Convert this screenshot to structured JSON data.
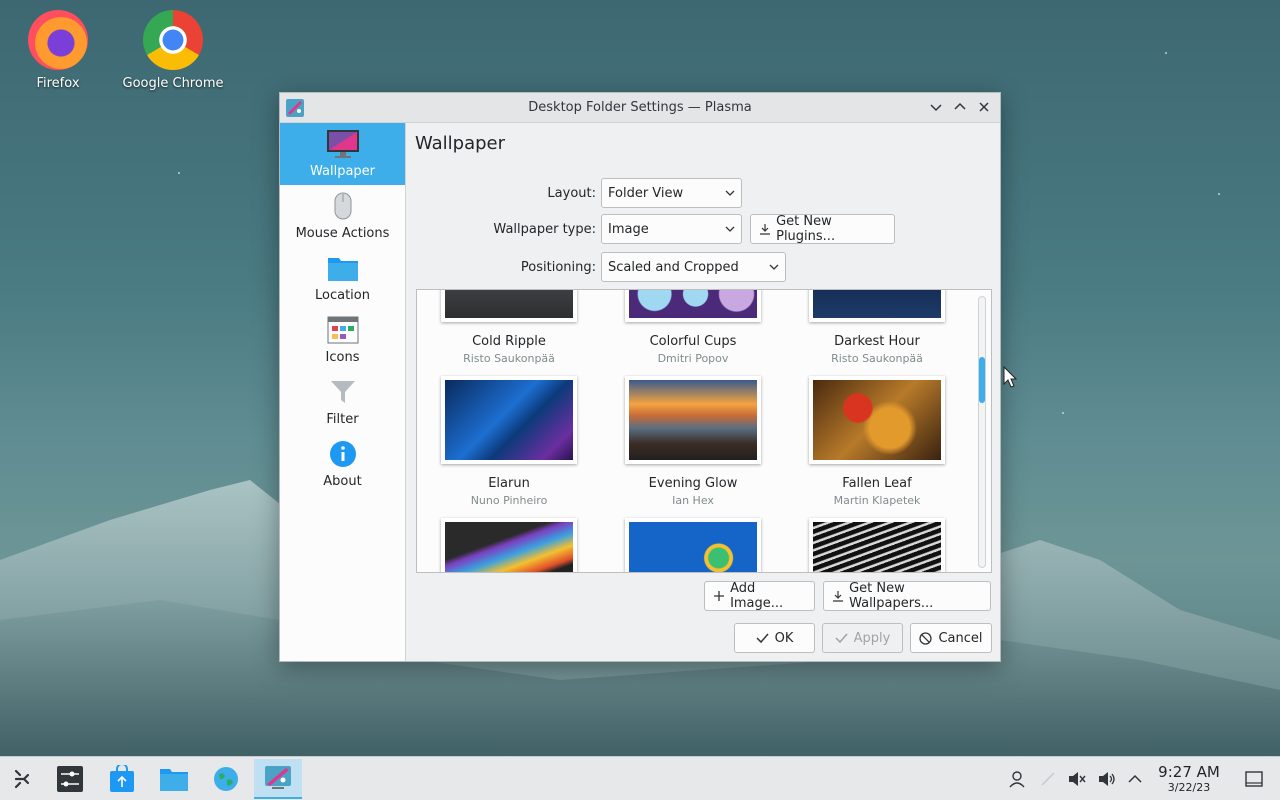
{
  "desktop": {
    "icons": [
      {
        "label": "Firefox"
      },
      {
        "label": "Google Chrome"
      }
    ]
  },
  "window": {
    "title": "Desktop Folder Settings — Plasma",
    "sidebar": [
      {
        "label": "Wallpaper",
        "icon": "monitor-icon",
        "active": true
      },
      {
        "label": "Mouse Actions",
        "icon": "mouse-icon"
      },
      {
        "label": "Location",
        "icon": "folder-icon"
      },
      {
        "label": "Icons",
        "icon": "icons-view-icon"
      },
      {
        "label": "Filter",
        "icon": "filter-icon"
      },
      {
        "label": "About",
        "icon": "info-icon"
      }
    ],
    "page_title": "Wallpaper",
    "form": {
      "layout_label": "Layout:",
      "layout_value": "Folder View",
      "type_label": "Wallpaper type:",
      "type_value": "Image",
      "get_plugins": "Get New Plugins...",
      "positioning_label": "Positioning:",
      "positioning_value": "Scaled and Cropped"
    },
    "wallpapers": [
      {
        "name": "Cold Ripple",
        "author": "Risto Saukonpää"
      },
      {
        "name": "Colorful Cups",
        "author": "Dmitri Popov"
      },
      {
        "name": "Darkest Hour",
        "author": "Risto Saukonpää"
      },
      {
        "name": "Elarun",
        "author": "Nuno Pinheiro"
      },
      {
        "name": "Evening Glow",
        "author": "Ian Hex"
      },
      {
        "name": "Fallen Leaf",
        "author": "Martin Klapetek"
      },
      {
        "name": "",
        "author": ""
      },
      {
        "name": "",
        "author": ""
      },
      {
        "name": "",
        "author": ""
      }
    ],
    "buttons": {
      "add_image": "Add Image...",
      "get_wallpapers": "Get New Wallpapers...",
      "ok": "OK",
      "apply": "Apply",
      "cancel": "Cancel"
    }
  },
  "taskbar": {
    "time": "9:27 AM",
    "date": "3/22/23"
  },
  "colors": {
    "accent": "#3daee9",
    "window_bg": "#eff0f1"
  }
}
